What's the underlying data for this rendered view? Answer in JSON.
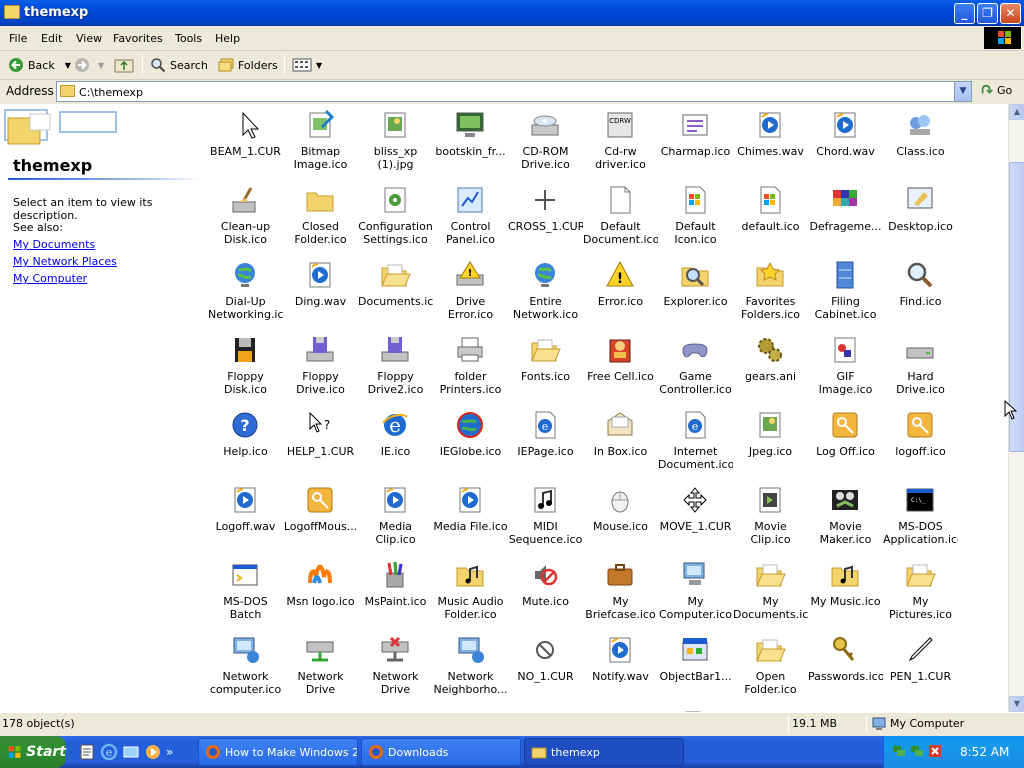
{
  "window": {
    "title": "themexp"
  },
  "menu": [
    "File",
    "Edit",
    "View",
    "Favorites",
    "Tools",
    "Help"
  ],
  "toolbar": {
    "back": "Back",
    "search": "Search",
    "folders": "Folders"
  },
  "address": {
    "label": "Address",
    "value": "C:\\themexp",
    "go": "Go"
  },
  "left_panel": {
    "title": "themexp",
    "description": "Select an item to view its description.",
    "see_also": "See also:",
    "links": [
      "My Documents",
      "My Network Places",
      "My Computer"
    ]
  },
  "files": [
    {
      "label": "",
      "icon": "cursor-icon"
    },
    {
      "label": "",
      "icon": "bitmap-icon"
    },
    {
      "label": "",
      "icon": "jpeg-icon"
    },
    {
      "label": "",
      "icon": "screen-icon"
    },
    {
      "label": "",
      "icon": "cdrom-icon"
    },
    {
      "label": "",
      "icon": "cdrw-icon"
    },
    {
      "label": "",
      "icon": "charmap-icon"
    },
    {
      "label": "",
      "icon": "sound-icon"
    },
    {
      "label": "",
      "icon": "sound-icon"
    },
    {
      "label": "",
      "icon": "class-icon"
    },
    {
      "label": "BEAM_1.CUR",
      "icon": "cursor-icon"
    },
    {
      "label": "Bitmap\nImage.ico",
      "icon": "bitmap-icon"
    },
    {
      "label": "bliss_xp\n(1).jpg",
      "icon": "jpeg-icon"
    },
    {
      "label": "bootskin_fr...",
      "icon": "screen-icon"
    },
    {
      "label": "CD-ROM\nDrive.ico",
      "icon": "cdrom-icon"
    },
    {
      "label": "Cd-rw\ndriver.ico",
      "icon": "cdrw-icon"
    },
    {
      "label": "Charmap.ico",
      "icon": "charmap-icon"
    },
    {
      "label": "Chimes.wav",
      "icon": "sound-icon"
    },
    {
      "label": "Chord.wav",
      "icon": "sound-icon"
    },
    {
      "label": "Class.ico",
      "icon": "class-icon"
    },
    {
      "label": "Clean-up\nDisk.ico",
      "icon": "cleanup-icon"
    },
    {
      "label": "Closed\nFolder.ico",
      "icon": "folder-icon"
    },
    {
      "label": "Configuration\nSettings.ico",
      "icon": "settings-icon"
    },
    {
      "label": "Control\nPanel.ico",
      "icon": "control-panel-icon"
    },
    {
      "label": "CROSS_1.CUR",
      "icon": "cross-icon"
    },
    {
      "label": "Default\nDocument.ico",
      "icon": "document-icon"
    },
    {
      "label": "Default\nIcon.ico",
      "icon": "windows-logo-icon"
    },
    {
      "label": "default.ico",
      "icon": "windows-logo-icon"
    },
    {
      "label": "Defrageme...",
      "icon": "defrag-icon"
    },
    {
      "label": "Desktop.ico",
      "icon": "desktop-icon"
    },
    {
      "label": "Dial-Up\nNetworking.ico",
      "icon": "globe-icon"
    },
    {
      "label": "Ding.wav",
      "icon": "sound-icon"
    },
    {
      "label": "Documents.ico",
      "icon": "open-folder-icon"
    },
    {
      "label": "Drive Error.ico",
      "icon": "drive-error-icon"
    },
    {
      "label": "Entire\nNetwork.ico",
      "icon": "globe-icon"
    },
    {
      "label": "Error.ico",
      "icon": "warning-icon"
    },
    {
      "label": "Explorer.ico",
      "icon": "explorer-icon"
    },
    {
      "label": "Favorites\nFolders.ico",
      "icon": "favorites-icon"
    },
    {
      "label": "Filing\nCabinet.ico",
      "icon": "cabinet-icon"
    },
    {
      "label": "Find.ico",
      "icon": "magnifier-icon"
    },
    {
      "label": "Floppy Disk.ico",
      "icon": "floppy-icon"
    },
    {
      "label": "Floppy\nDrive.ico",
      "icon": "floppy-drive-icon"
    },
    {
      "label": "Floppy\nDrive2.ico",
      "icon": "floppy-drive-icon"
    },
    {
      "label": "folder\nPrinters.ico",
      "icon": "printer-icon"
    },
    {
      "label": "Fonts.ico",
      "icon": "open-folder-icon"
    },
    {
      "label": "Free Cell.ico",
      "icon": "freecell-icon"
    },
    {
      "label": "Game\nController.ico",
      "icon": "gamepad-icon"
    },
    {
      "label": "gears.ani",
      "icon": "gears-icon"
    },
    {
      "label": "GIF Image.ico",
      "icon": "gif-icon"
    },
    {
      "label": "Hard Drive.ico",
      "icon": "hard-drive-icon"
    },
    {
      "label": "Help.ico",
      "icon": "help-icon"
    },
    {
      "label": "HELP_1.CUR",
      "icon": "help-cursor-icon"
    },
    {
      "label": "IE.ico",
      "icon": "ie-icon"
    },
    {
      "label": "IEGlobe.ico",
      "icon": "ie-globe-icon"
    },
    {
      "label": "IEPage.ico",
      "icon": "ie-page-icon"
    },
    {
      "label": "In Box.ico",
      "icon": "inbox-icon"
    },
    {
      "label": "Internet\nDocument.ico",
      "icon": "ie-page-icon"
    },
    {
      "label": "Jpeg.ico",
      "icon": "jpeg-icon"
    },
    {
      "label": "Log Off.ico",
      "icon": "key-icon"
    },
    {
      "label": "logoff.ico",
      "icon": "key-icon"
    },
    {
      "label": "Logoff.wav",
      "icon": "sound-icon"
    },
    {
      "label": "LogoffMous...",
      "icon": "key-icon"
    },
    {
      "label": "Media Clip.ico",
      "icon": "sound-icon"
    },
    {
      "label": "Media File.ico",
      "icon": "sound-icon"
    },
    {
      "label": "MIDI\nSequence.ico",
      "icon": "midi-icon"
    },
    {
      "label": "Mouse.ico",
      "icon": "mouse-icon"
    },
    {
      "label": "MOVE_1.CUR",
      "icon": "move-cursor-icon"
    },
    {
      "label": "Movie Clip.ico",
      "icon": "film-icon"
    },
    {
      "label": "Movie\nMaker.ico",
      "icon": "movie-maker-icon"
    },
    {
      "label": "MS-DOS\nApplication.ico",
      "icon": "msdos-icon"
    },
    {
      "label": "MS-DOS Batch\nFile.ico",
      "icon": "batch-icon"
    },
    {
      "label": "Msn logo.ico",
      "icon": "msn-icon"
    },
    {
      "label": "MsPaint.ico",
      "icon": "paint-icon"
    },
    {
      "label": "Music Audio\nFolder.ico",
      "icon": "music-folder-icon"
    },
    {
      "label": "Mute.ico",
      "icon": "mute-icon"
    },
    {
      "label": "My\nBriefcase.ico",
      "icon": "briefcase-icon"
    },
    {
      "label": "My\nComputer.ico",
      "icon": "computer-icon"
    },
    {
      "label": "My\nDocuments.ico",
      "icon": "open-folder-icon"
    },
    {
      "label": "My Music.ico",
      "icon": "music-folder-icon"
    },
    {
      "label": "My\nPictures.ico",
      "icon": "open-folder-icon"
    },
    {
      "label": "Network\ncomputer.ico",
      "icon": "network-computer-icon"
    },
    {
      "label": "Network Drive\n(connected...",
      "icon": "network-drive-icon"
    },
    {
      "label": "Network Drive\n(offline).ico",
      "icon": "network-drive-offline-icon"
    },
    {
      "label": "Network\nNeighborho...",
      "icon": "network-computer-icon"
    },
    {
      "label": "NO_1.CUR",
      "icon": "no-cursor-icon"
    },
    {
      "label": "Notify.wav",
      "icon": "sound-icon"
    },
    {
      "label": "ObjectBar1...",
      "icon": "objectbar-icon"
    },
    {
      "label": "Open\nFolder.ico",
      "icon": "open-folder-icon"
    },
    {
      "label": "Passwords.ico",
      "icon": "keys-icon"
    },
    {
      "label": "PEN_1.CUR",
      "icon": "pen-cursor-icon"
    },
    {
      "label": "",
      "icon": "computer-icon"
    },
    {
      "label": "",
      "icon": "printer-icon"
    },
    {
      "label": "",
      "icon": "printer-icon"
    },
    {
      "label": "",
      "icon": "control-panel-icon"
    },
    {
      "label": "",
      "icon": "window-icon"
    },
    {
      "label": "",
      "icon": "drive-icon"
    },
    {
      "label": "",
      "icon": "document-icon"
    },
    {
      "label": "",
      "icon": "recycle-icon"
    },
    {
      "label": "",
      "icon": "recycle-icon"
    },
    {
      "label": "",
      "icon": "sound-icon"
    }
  ],
  "status": {
    "objects": "178 object(s)",
    "size": "19.1 MB",
    "location": "My Computer"
  },
  "taskbar": {
    "start": "Start",
    "tasks": [
      "How to Make Windows 2...",
      "Downloads",
      "themexp"
    ],
    "clock": "8:52 AM"
  }
}
